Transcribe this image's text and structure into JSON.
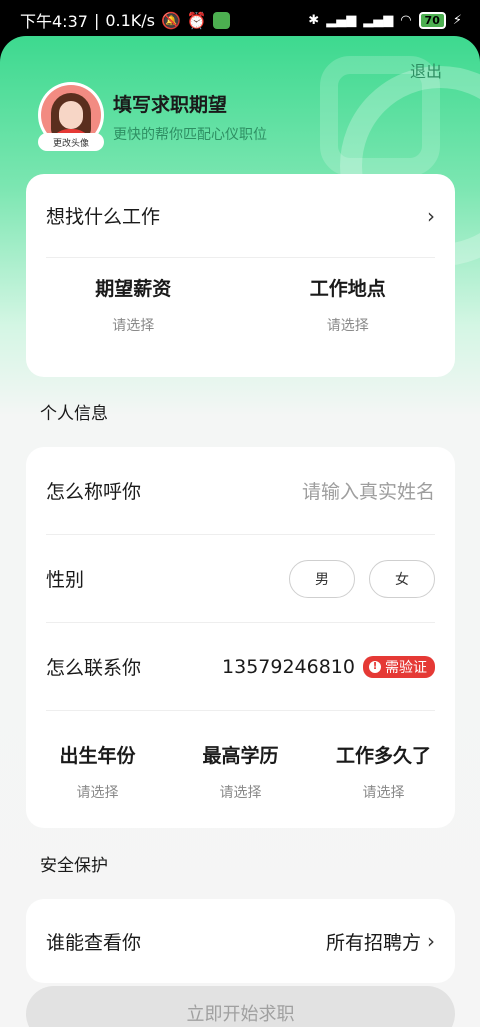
{
  "status_bar": {
    "time": "下午4:37",
    "speed": "0.1K/s",
    "battery": "70"
  },
  "header": {
    "logout": "退出",
    "avatar_caption": "更改头像",
    "title": "填写求职期望",
    "subtitle": "更快的帮你匹配心仪职位"
  },
  "job_card": {
    "job_label": "想找什么工作",
    "salary_label": "期望薪资",
    "salary_value": "请选择",
    "location_label": "工作地点",
    "location_value": "请选择"
  },
  "personal": {
    "section_title": "个人信息",
    "name_label": "怎么称呼你",
    "name_placeholder": "请输入真实姓名",
    "gender_label": "性别",
    "male": "男",
    "female": "女",
    "contact_label": "怎么联系你",
    "phone": "13579246810",
    "verify_badge": "需验证",
    "birth_label": "出生年份",
    "birth_value": "请选择",
    "edu_label": "最高学历",
    "edu_value": "请选择",
    "exp_label": "工作多久了",
    "exp_value": "请选择"
  },
  "security": {
    "section_title": "安全保护",
    "visibility_label": "谁能查看你",
    "visibility_value": "所有招聘方"
  },
  "start_button": "立即开始求职"
}
